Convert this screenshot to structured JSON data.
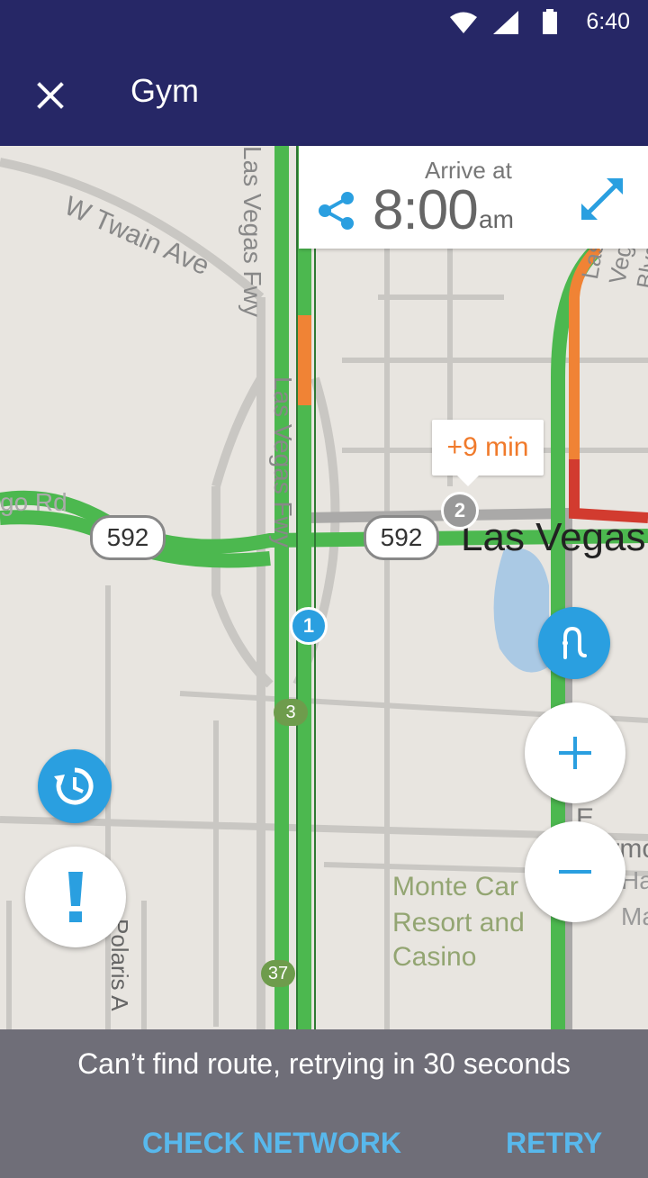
{
  "status_bar": {
    "time": "6:40"
  },
  "app_bar": {
    "title": "Gym"
  },
  "arrive": {
    "label": "Arrive at",
    "time": "8:00",
    "ampm": "am"
  },
  "map": {
    "street_labels": [
      "W Twain Ave",
      "Las Vegas Fwy",
      "Las Vegas Fwy",
      "Las Vegas Blvd",
      "Las Vegas",
      "go Rd",
      "Polaris A",
      "E Harmon",
      "Ha",
      "Ma",
      "Monte Car",
      "Resort and",
      "Casino"
    ],
    "shields": [
      "592",
      "592"
    ],
    "markers": [
      "1",
      "2"
    ],
    "exit_numbers": [
      "3",
      "37"
    ],
    "delay_label": "+9 min"
  },
  "snackbar": {
    "message": "Can’t find route, retrying in 30 seconds",
    "check_network": "CHECK NETWORK",
    "retry": "RETRY"
  },
  "colors": {
    "app_bar": "#262766",
    "route_green": "#4cb84f",
    "route_orange": "#f08335",
    "route_red": "#d23b2f",
    "accent_blue": "#2a9fe0",
    "snackbar": "#6f6e78",
    "action_text": "#58b8ec"
  }
}
